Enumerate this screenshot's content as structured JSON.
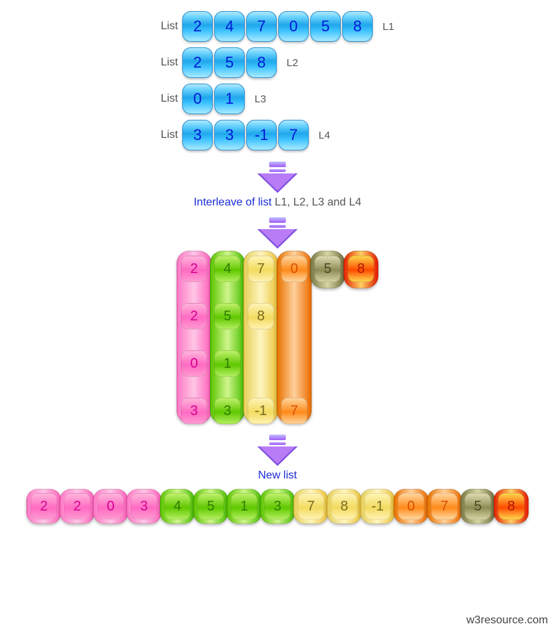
{
  "label_list": "List",
  "lists": {
    "L1": {
      "name": "L1",
      "values": [
        "2",
        "4",
        "7",
        "0",
        "5",
        "8"
      ]
    },
    "L2": {
      "name": "L2",
      "values": [
        "2",
        "5",
        "8"
      ]
    },
    "L3": {
      "name": "L3",
      "values": [
        "0",
        "1"
      ]
    },
    "L4": {
      "name": "L4",
      "values": [
        "3",
        "3",
        "-1",
        "7"
      ]
    }
  },
  "caption1_prefix": "Interleave of list ",
  "caption1_lists": "L1, L2, L3 and L4",
  "caption_newlist": "New list",
  "matrix": {
    "col0": [
      "2",
      "2",
      "0",
      "3"
    ],
    "col1": [
      "4",
      "5",
      "1",
      "3"
    ],
    "col2": [
      "7",
      "8",
      "",
      "-1"
    ],
    "col3": [
      "0",
      "",
      "",
      "7"
    ],
    "col4": [
      "5"
    ],
    "col5": [
      "8"
    ]
  },
  "newlist": {
    "items": [
      {
        "v": "2",
        "c": "pink"
      },
      {
        "v": "2",
        "c": "pink"
      },
      {
        "v": "0",
        "c": "pink"
      },
      {
        "v": "3",
        "c": "pink"
      },
      {
        "v": "4",
        "c": "green"
      },
      {
        "v": "5",
        "c": "green"
      },
      {
        "v": "1",
        "c": "green"
      },
      {
        "v": "3",
        "c": "green"
      },
      {
        "v": "7",
        "c": "yellow"
      },
      {
        "v": "8",
        "c": "yellow"
      },
      {
        "v": "-1",
        "c": "yellow"
      },
      {
        "v": "0",
        "c": "orange"
      },
      {
        "v": "7",
        "c": "orange"
      },
      {
        "v": "5",
        "c": "olive"
      },
      {
        "v": "8",
        "c": "red"
      }
    ]
  },
  "brand": "w3resource.com"
}
